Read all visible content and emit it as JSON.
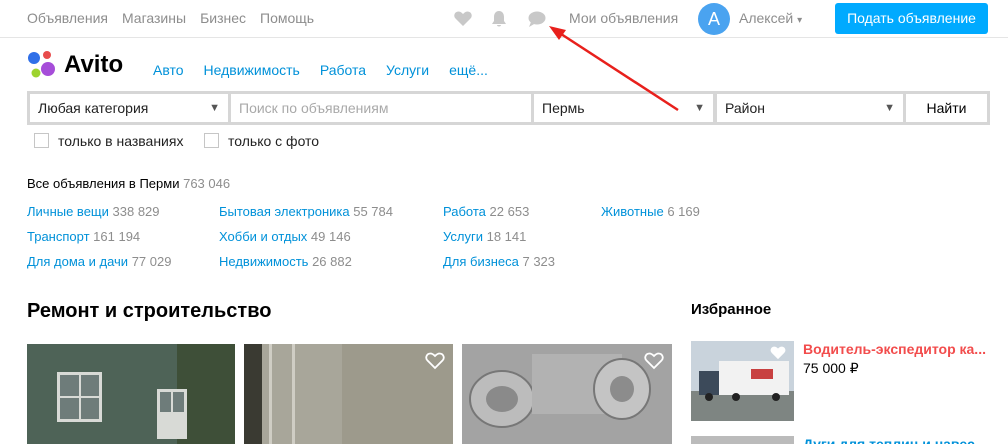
{
  "topbar": {
    "nav": [
      "Объявления",
      "Магазины",
      "Бизнес",
      "Помощь"
    ],
    "icons": [
      "heart-icon",
      "bell-icon",
      "chat-icon"
    ],
    "my_ads": "Мои объявления",
    "avatar_letter": "А",
    "user_name": "Алексей",
    "post_button": "Подать объявление"
  },
  "logo": {
    "text": "Avito"
  },
  "categories": [
    "Авто",
    "Недвижимость",
    "Работа",
    "Услуги",
    "ещё..."
  ],
  "search": {
    "category": "Любая категория",
    "placeholder": "Поиск по объявлениям",
    "city": "Пермь",
    "district": "Район",
    "button": "Найти"
  },
  "filters": {
    "titles_only": "только в названиях",
    "with_photo": "только с фото"
  },
  "all_ads": {
    "label": "Все объявления в Перми",
    "count": "763 046"
  },
  "category_counts": [
    {
      "name": "Личные вещи",
      "count": "338 829"
    },
    {
      "name": "Транспорт",
      "count": "161 194"
    },
    {
      "name": "Для дома и дачи",
      "count": "77 029"
    },
    {
      "name": "Бытовая электроника",
      "count": "55 784"
    },
    {
      "name": "Хобби и отдых",
      "count": "49 146"
    },
    {
      "name": "Недвижимость",
      "count": "26 882"
    },
    {
      "name": "Работа",
      "count": "22 653"
    },
    {
      "name": "Услуги",
      "count": "18 141"
    },
    {
      "name": "Для бизнеса",
      "count": "7 323"
    },
    {
      "name": "Животные",
      "count": "6 169"
    }
  ],
  "section": {
    "title": "Ремонт и строительство"
  },
  "favorites": {
    "title": "Избранное",
    "items": [
      {
        "name": "Водитель-экспедитор ка...",
        "price": "75 000 ₽"
      },
      {
        "name": "Дуги для теплиц и навес..."
      }
    ]
  },
  "colors": {
    "accent": "#00aaff",
    "link": "#0091d9",
    "muted": "#8d8d8d",
    "fav_title": "#f24c4c",
    "annotation": "#e8201c"
  }
}
